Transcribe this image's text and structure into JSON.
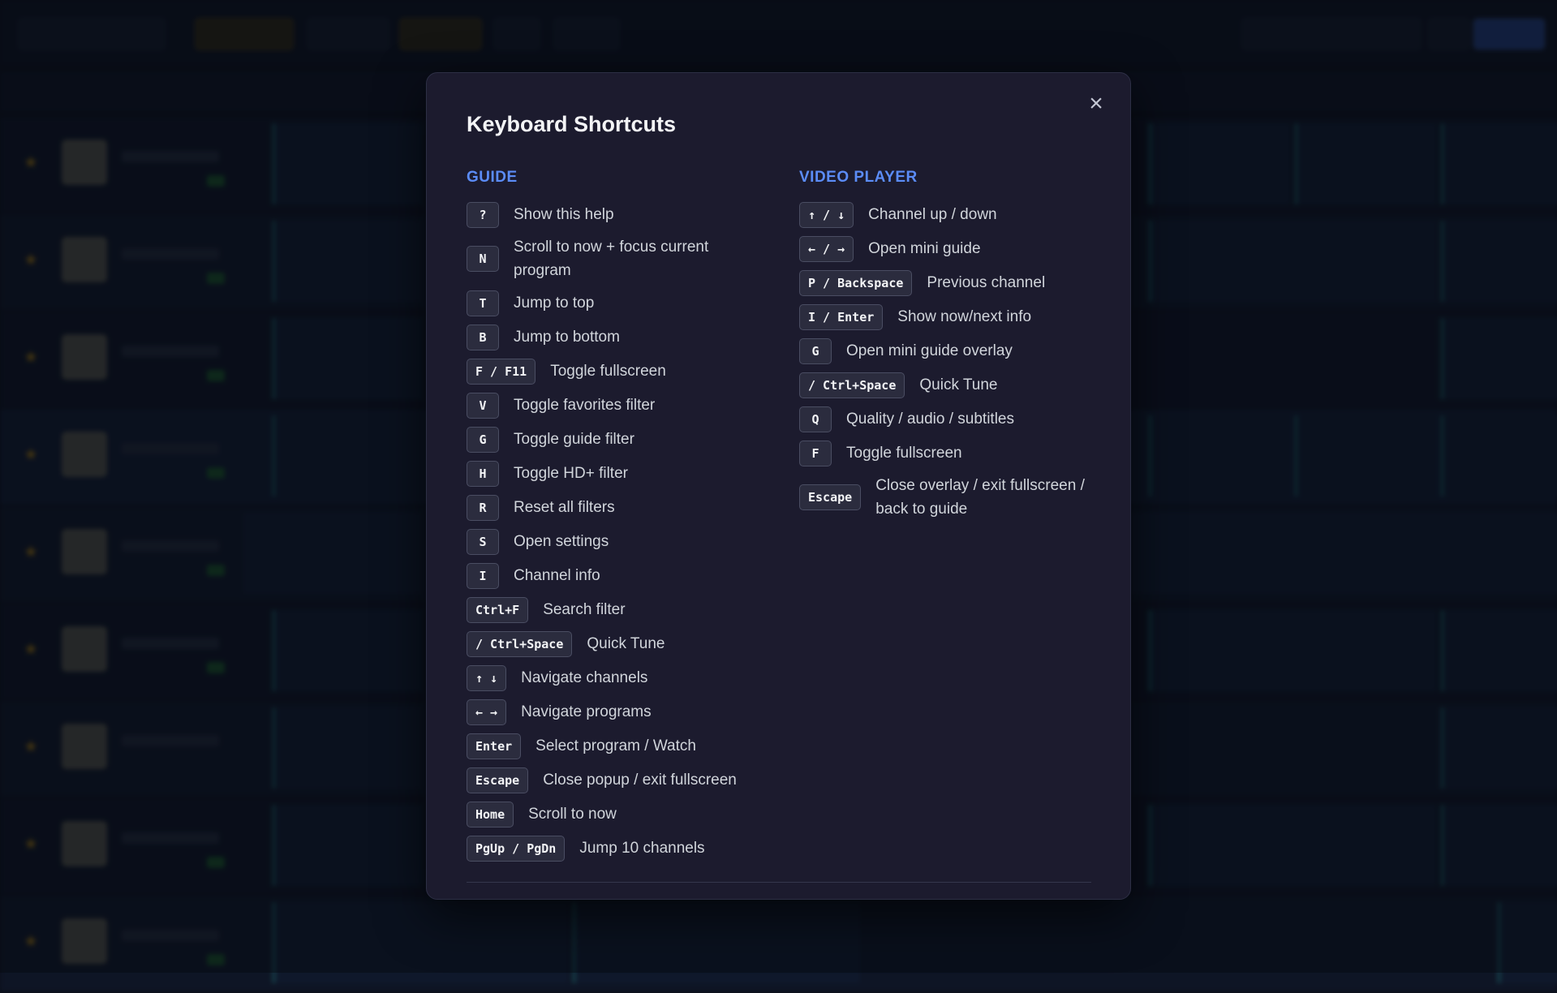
{
  "modal": {
    "title": "Keyboard Shortcuts",
    "close_label": "×"
  },
  "guide": {
    "title": "GUIDE",
    "items": [
      {
        "key": "?",
        "desc": "Show this help"
      },
      {
        "key": "N",
        "desc": "Scroll to now + focus current program"
      },
      {
        "key": "T",
        "desc": "Jump to top"
      },
      {
        "key": "B",
        "desc": "Jump to bottom"
      },
      {
        "key": "F / F11",
        "desc": "Toggle fullscreen"
      },
      {
        "key": "V",
        "desc": "Toggle favorites filter"
      },
      {
        "key": "G",
        "desc": "Toggle guide filter"
      },
      {
        "key": "H",
        "desc": "Toggle HD+ filter"
      },
      {
        "key": "R",
        "desc": "Reset all filters"
      },
      {
        "key": "S",
        "desc": "Open settings"
      },
      {
        "key": "I",
        "desc": "Channel info"
      },
      {
        "key": "Ctrl+F",
        "desc": "Search filter"
      },
      {
        "key": "/ Ctrl+Space",
        "desc": "Quick Tune"
      },
      {
        "key": "↑ ↓",
        "desc": "Navigate channels"
      },
      {
        "key": "← →",
        "desc": "Navigate programs"
      },
      {
        "key": "Enter",
        "desc": "Select program / Watch"
      },
      {
        "key": "Escape",
        "desc": "Close popup / exit fullscreen"
      },
      {
        "key": "Home",
        "desc": "Scroll to now"
      },
      {
        "key": "PgUp / PgDn",
        "desc": "Jump 10 channels"
      }
    ]
  },
  "video": {
    "title": "VIDEO PLAYER",
    "items": [
      {
        "key": "↑ / ↓",
        "desc": "Channel up / down"
      },
      {
        "key": "← / →",
        "desc": "Open mini guide"
      },
      {
        "key": "P / Backspace",
        "desc": "Previous channel"
      },
      {
        "key": "I / Enter",
        "desc": "Show now/next info"
      },
      {
        "key": "G",
        "desc": "Open mini guide overlay"
      },
      {
        "key": "/ Ctrl+Space",
        "desc": "Quick Tune"
      },
      {
        "key": "Q",
        "desc": "Quality / audio / subtitles"
      },
      {
        "key": "F",
        "desc": "Toggle fullscreen"
      },
      {
        "key": "Escape",
        "desc": "Close overlay / exit fullscreen / back to guide"
      }
    ]
  },
  "colors": {
    "accent": "#5b8cf7",
    "modal_bg": "#1c1b2e",
    "key_bg": "#2b2c3e"
  }
}
